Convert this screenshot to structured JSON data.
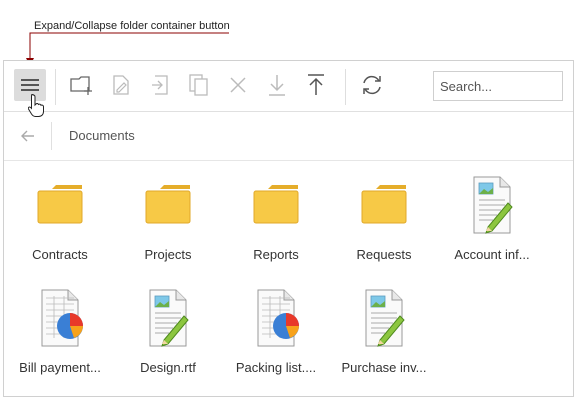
{
  "callout": {
    "text": "Expand/Collapse folder container button"
  },
  "toolbar": {
    "buttons": [
      {
        "name": "menu-button",
        "icon": "hamburger-icon"
      },
      {
        "name": "new-folder-button",
        "icon": "new-folder-icon"
      },
      {
        "name": "rename-button",
        "icon": "rename-icon"
      },
      {
        "name": "move-button",
        "icon": "move-icon"
      },
      {
        "name": "copy-button",
        "icon": "copy-icon"
      },
      {
        "name": "delete-button",
        "icon": "delete-icon"
      },
      {
        "name": "download-button",
        "icon": "download-icon"
      },
      {
        "name": "upload-button",
        "icon": "upload-icon"
      },
      {
        "name": "refresh-button",
        "icon": "refresh-icon"
      }
    ],
    "search_placeholder": "Search..."
  },
  "breadcrumb": {
    "current": "Documents"
  },
  "items": [
    {
      "label": "Contracts",
      "type": "folder"
    },
    {
      "label": "Projects",
      "type": "folder"
    },
    {
      "label": "Reports",
      "type": "folder"
    },
    {
      "label": "Requests",
      "type": "folder"
    },
    {
      "label": "Account inf...",
      "type": "document"
    },
    {
      "label": "Bill payment...",
      "type": "spreadsheet"
    },
    {
      "label": "Design.rtf",
      "type": "document"
    },
    {
      "label": "Packing list....",
      "type": "spreadsheet"
    },
    {
      "label": "Purchase inv...",
      "type": "document"
    }
  ],
  "colors": {
    "callout_line": "#8b0000",
    "folder": "#f5c542",
    "toolbar_icon_active": "#555555",
    "toolbar_icon_disabled": "#bbbbbb"
  }
}
